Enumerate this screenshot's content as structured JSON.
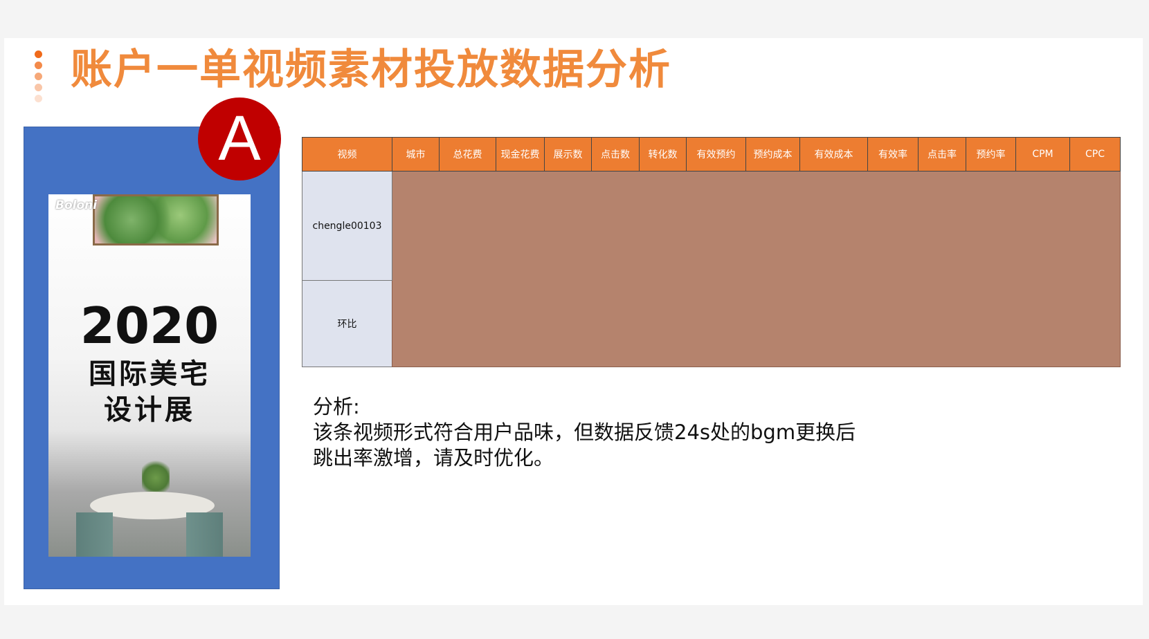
{
  "title": "账户一单视频素材投放数据分析",
  "colors": {
    "accent": "#f08a3c",
    "header_fill": "#ed7d31",
    "data_fill": "#b5836d",
    "frame": "#4472c4",
    "badge": "#c00000",
    "label_fill": "#dfe3ee"
  },
  "decor_dots": [
    "#f06a1a",
    "#f38a4a",
    "#f6a878",
    "#f9c6a8",
    "#fce0d0"
  ],
  "poster": {
    "brand": "Boloni",
    "year": "2020",
    "line1": "国际美宅",
    "line2": "设计展"
  },
  "badge_letter": "A",
  "table": {
    "headers": [
      "视频",
      "城市",
      "总花费",
      "现金花费",
      "展示数",
      "点击数",
      "转化数",
      "有效预约",
      "预约成本",
      "有效成本",
      "有效率",
      "点击率",
      "预约率",
      "CPM",
      "CPC"
    ],
    "rows": [
      {
        "label": "chengle00103"
      },
      {
        "label": "环比"
      }
    ]
  },
  "analysis": {
    "heading": "分析:",
    "line1": "该条视频形式符合用户品味，但数据反馈24s处的bgm更换后",
    "line2": "跳出率激增，请及时优化。"
  }
}
